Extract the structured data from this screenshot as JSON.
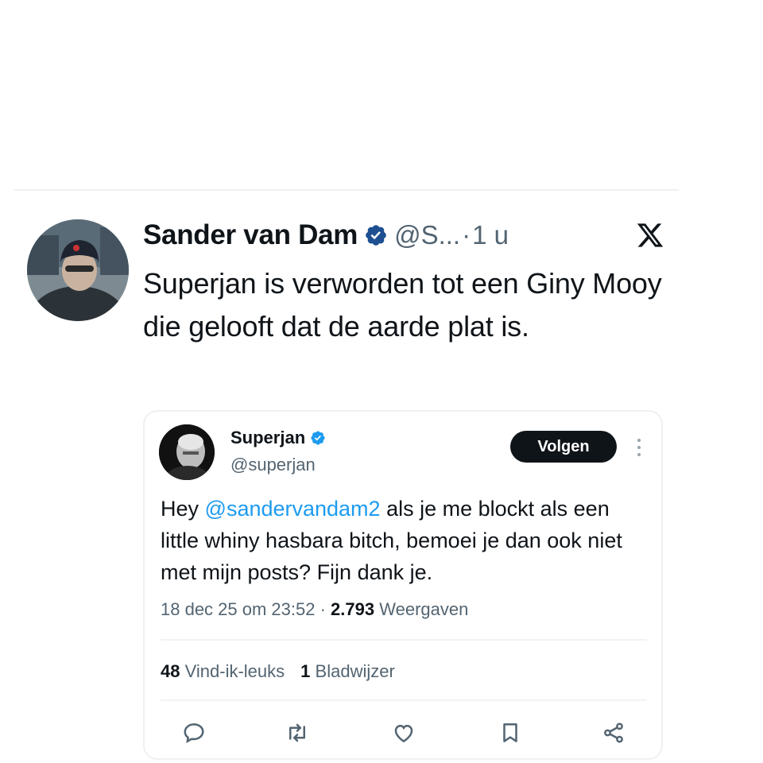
{
  "tweet": {
    "author_name": "Sander van Dam",
    "handle": "@S...",
    "separator": "·",
    "time": "1 u",
    "text": "Superjan is verworden tot een Giny Mooy die gelooft dat de aarde plat is.",
    "platform_icon": "x-logo-icon"
  },
  "quoted_tweet": {
    "author_name": "Superjan",
    "handle": "@superjan",
    "follow_label": "Volgen",
    "text_prefix": "Hey ",
    "mention": "@sandervandam2",
    "text_suffix": " als je me blockt als een little whiny hasbara bitch, bemoei je dan ook niet met mijn posts? Fijn dank je.",
    "datetime": "18 dec 25 om 23:52",
    "meta_separator": " · ",
    "views_count": "2.793",
    "views_label": "Weergaven",
    "likes_count": "48",
    "likes_label": "Vind-ik-leuks",
    "bookmarks_count": "1",
    "bookmarks_label": "Bladwijzer",
    "actions": [
      "reply-icon",
      "repost-icon",
      "like-icon",
      "bookmark-icon",
      "share-icon"
    ]
  },
  "colors": {
    "text_primary": "#0f1419",
    "text_secondary": "#536471",
    "verified_blue": "#1d9bf0",
    "mention_blue": "#1d9bf0",
    "button_dark": "#0f1419"
  }
}
